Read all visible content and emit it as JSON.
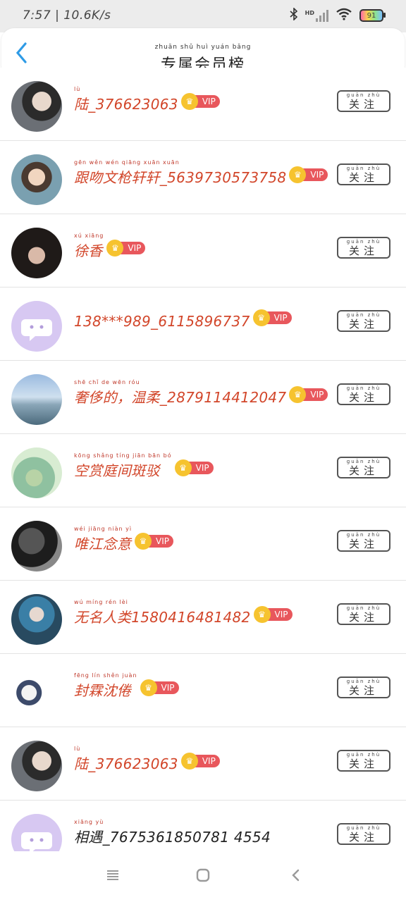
{
  "status_bar": {
    "time": "7:57 | 10.6K/s",
    "network": "HD",
    "battery": "91"
  },
  "header": {
    "back_icon": "chevron-left-icon",
    "title_pinyin": "zhuān shǔ huì yuán bǎng",
    "title": "专属会员榜"
  },
  "follow_pinyin": "guān zhù",
  "follow_label": "关注",
  "vip_label": "VIP",
  "members": [
    {
      "pinyin": "lù",
      "name": "陆_376623063",
      "vip": true
    },
    {
      "pinyin": "gēn wěn wén qiāng xuān xuān",
      "name": "跟吻文枪轩轩_5639730573758",
      "vip": true
    },
    {
      "pinyin": "xú xiāng",
      "name": "徐香",
      "vip": true
    },
    {
      "pinyin": "",
      "name": "138***989_6115896737",
      "vip": true
    },
    {
      "pinyin": "shē chǐ de wēn róu",
      "name": "奢侈的，温柔_2879114412047",
      "vip": true
    },
    {
      "pinyin": "kōng shǎng tíng jiān bān bó",
      "name": "空赏庭间斑驳",
      "vip": true
    },
    {
      "pinyin": "wéi jiāng niàn yì",
      "name": "唯江念意",
      "vip": true
    },
    {
      "pinyin": "wú míng rén lèi",
      "name": "无名人类1580416481482",
      "vip": true
    },
    {
      "pinyin": "fēng lín shěn juàn",
      "name": "封霖沈倦",
      "vip": true
    },
    {
      "pinyin": "lù",
      "name": "陆_376623063",
      "vip": true
    },
    {
      "pinyin": "xiāng yù",
      "name": "相遇_7675361850781 4554",
      "vip": false
    }
  ]
}
